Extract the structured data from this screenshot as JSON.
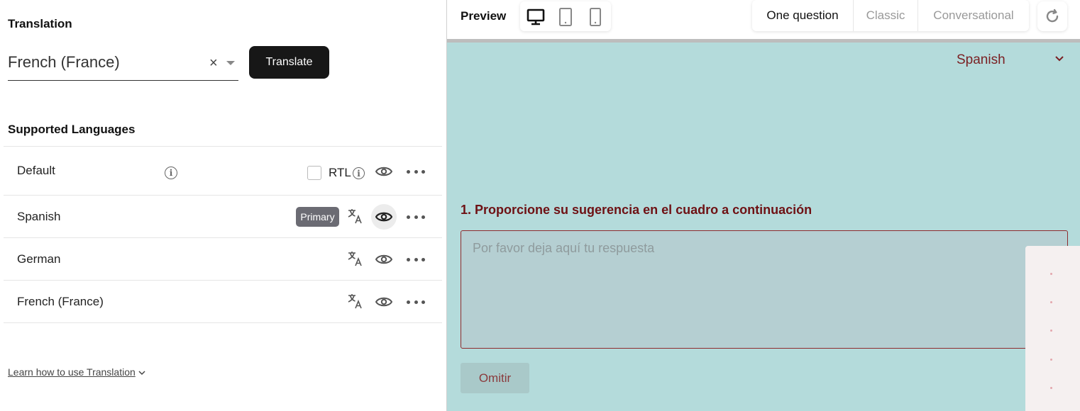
{
  "left": {
    "translation_title": "Translation",
    "selected_language": "French (France)",
    "clear_symbol": "×",
    "translate_button": "Translate",
    "supported_title": "Supported Languages",
    "languages": [
      {
        "name": "Default",
        "rtl_label": "RTL"
      },
      {
        "name": "Spanish",
        "badge": "Primary"
      },
      {
        "name": "German"
      },
      {
        "name": "French (France)"
      }
    ],
    "learn_link": "Learn how to use Translation"
  },
  "right": {
    "preview_label": "Preview",
    "modes": [
      "One question",
      "Classic",
      "Conversational"
    ],
    "active_mode": "One question",
    "survey": {
      "language": "Spanish",
      "question": "1. Proporcione su sugerencia en el cuadro a continuación",
      "placeholder": "Por favor deja aquí tu respuesta",
      "omit_button": "Omitir"
    }
  },
  "colors": {
    "canvas_bg": "#b4dbdb",
    "accent_dark_red": "#6e1114",
    "translate_btn_bg": "#171717",
    "primary_badge_bg": "#6b6b73"
  },
  "icons": [
    "info-icon",
    "translate-icon",
    "eye-icon",
    "more-dots-icon",
    "desktop-icon",
    "tablet-icon",
    "mobile-icon",
    "refresh-icon",
    "chevron-down-icon",
    "resize-handle-icon"
  ]
}
